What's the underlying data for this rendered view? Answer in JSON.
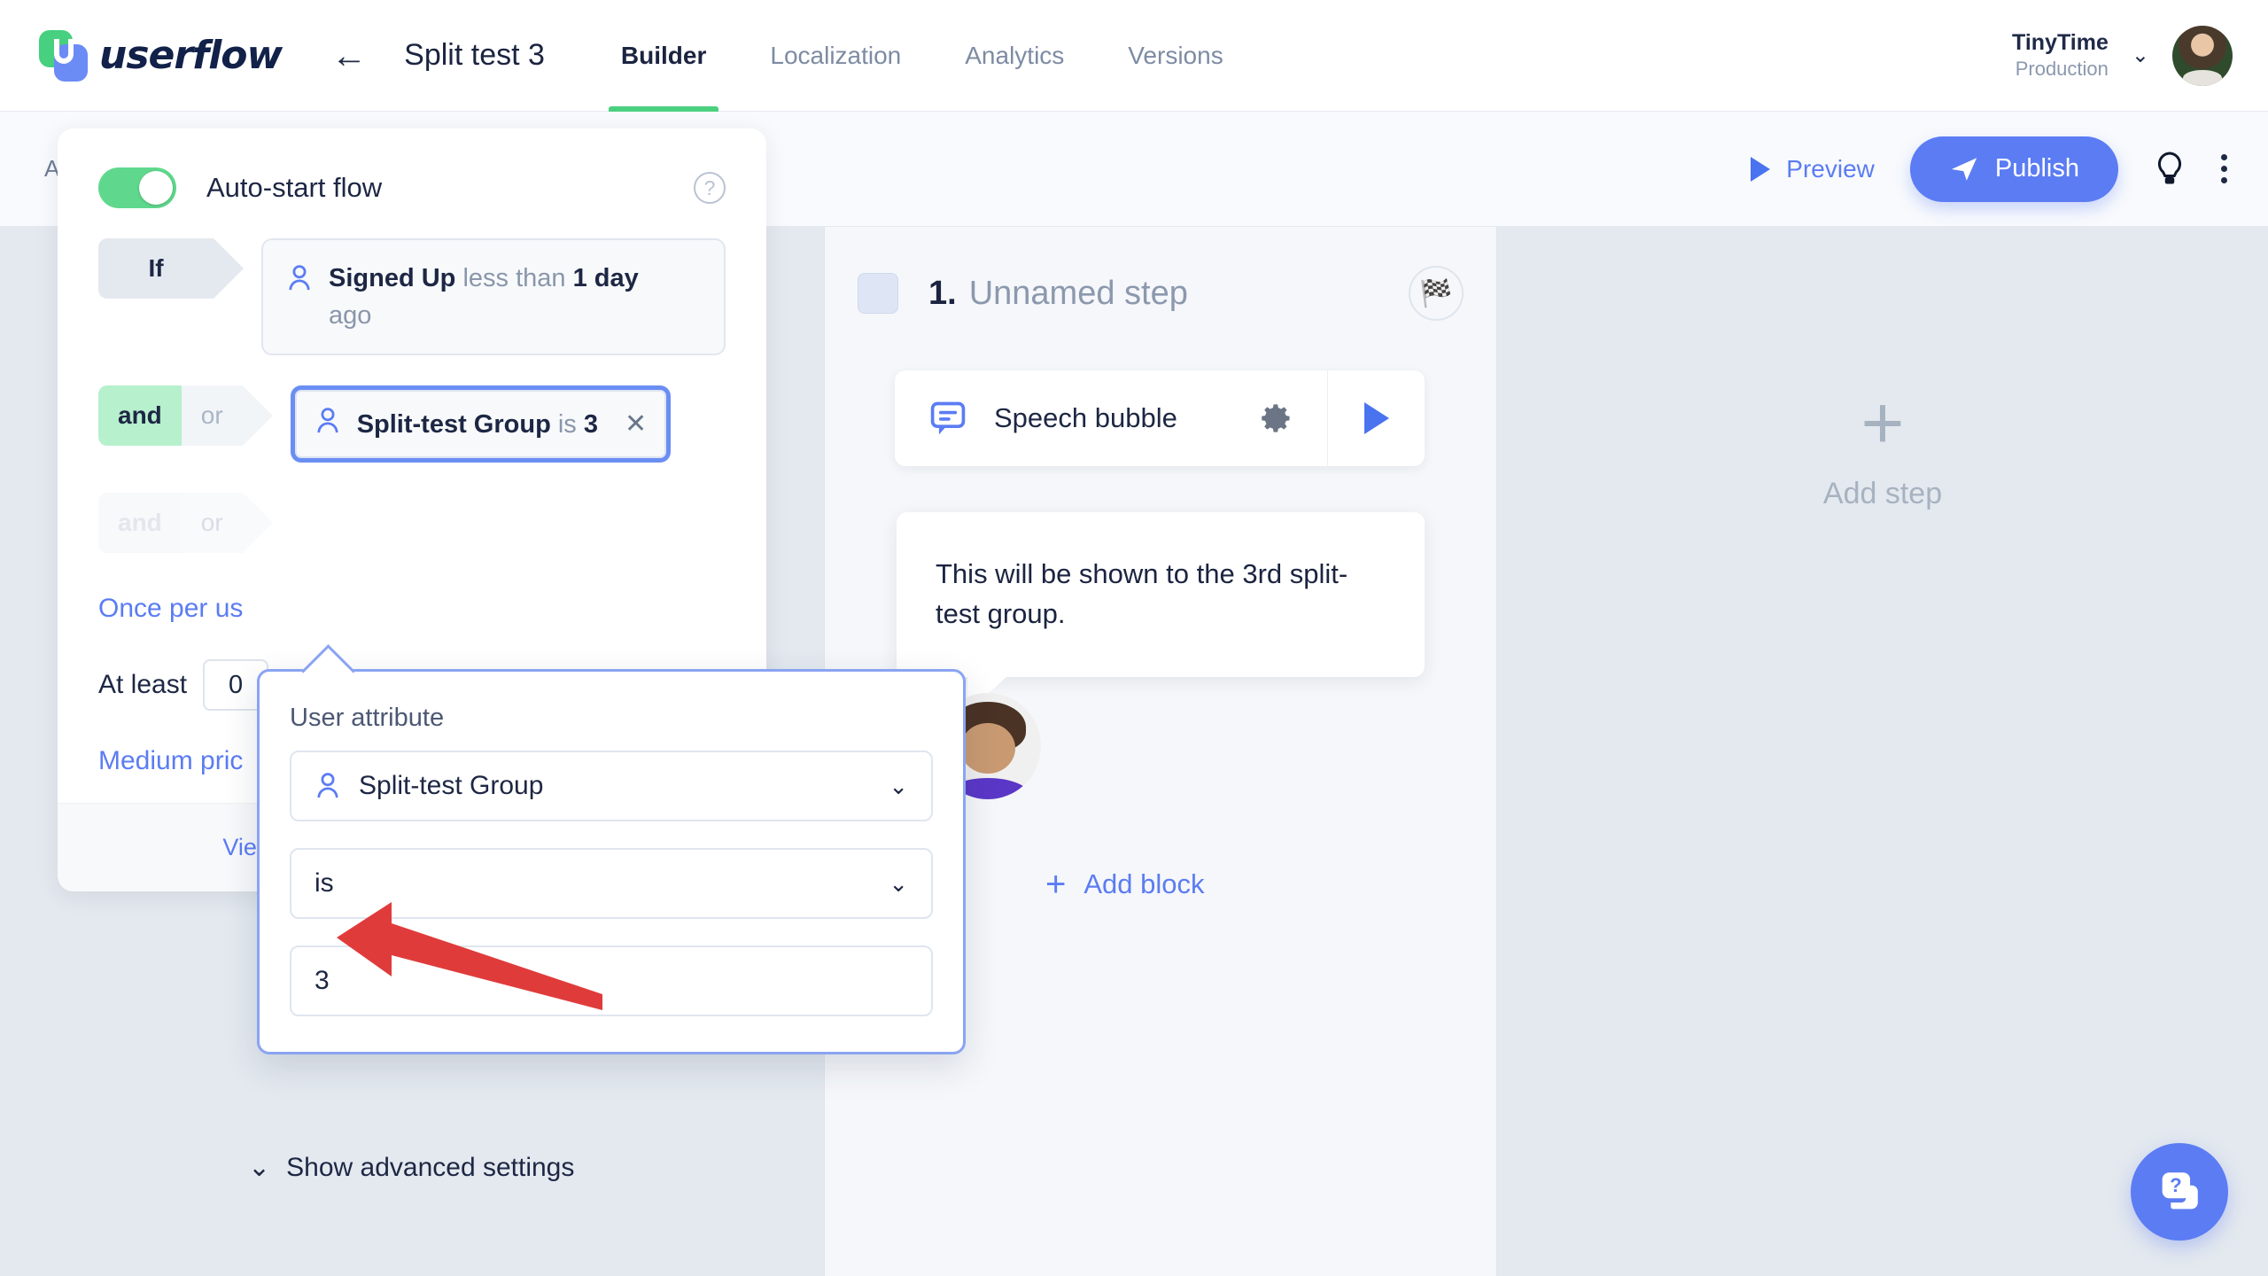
{
  "topnav": {
    "logo_text": "userflow",
    "back_label": "←",
    "flow_title": "Split test 3",
    "tabs": [
      {
        "label": "Builder",
        "active": true
      },
      {
        "label": "Localization",
        "active": false
      },
      {
        "label": "Analytics",
        "active": false
      },
      {
        "label": "Versions",
        "active": false
      }
    ],
    "workspace_name": "TinyTime",
    "workspace_env": "Production",
    "chevron": "⌄"
  },
  "toolbar": {
    "autosaved": "Autosaved just now",
    "preview_label": "Preview",
    "publish_label": "Publish"
  },
  "start_card": {
    "toggle_label": "Auto-start flow",
    "help_glyph": "?",
    "condition_rows": [
      {
        "chip": "If",
        "text_html": "<b>Signed Up</b> <span class=\"muted\">less than</span> <b>1 day</b><br><span class=\"muted\">ago</span>"
      }
    ],
    "and_label": "and",
    "or_label": "or",
    "selected_condition": {
      "attribute": "Split-test Group",
      "operator": "is",
      "value": "3",
      "close_glyph": "✕"
    },
    "once_per_user": "Once per us",
    "at_least_label": "At least",
    "at_least_value": "0",
    "medium_priority": "Medium pric",
    "footer_link": "View other ways to start this flow",
    "advanced_settings": "Show advanced settings",
    "advanced_chevron": "⌄"
  },
  "popover": {
    "label": "User attribute",
    "attribute_value": "Split-test Group",
    "operator_value": "is",
    "comparison_value": "3",
    "chevron": "⌄"
  },
  "canvas": {
    "step_number": "1.",
    "step_name": "Unnamed step",
    "flag_icon": "🏁",
    "block_label": "Speech bubble",
    "tooltip_text": "This will be shown to the 3rd split-test group.",
    "add_block_label": "Add block",
    "add_block_plus": "+",
    "add_step_label": "Add step",
    "add_step_plus": "+"
  },
  "colors": {
    "accent_blue": "#5b7cf3",
    "green": "#5fd88d",
    "arrow_red": "#e03b3b",
    "text_dark": "#1d2744",
    "text_muted": "#8a96aa"
  }
}
